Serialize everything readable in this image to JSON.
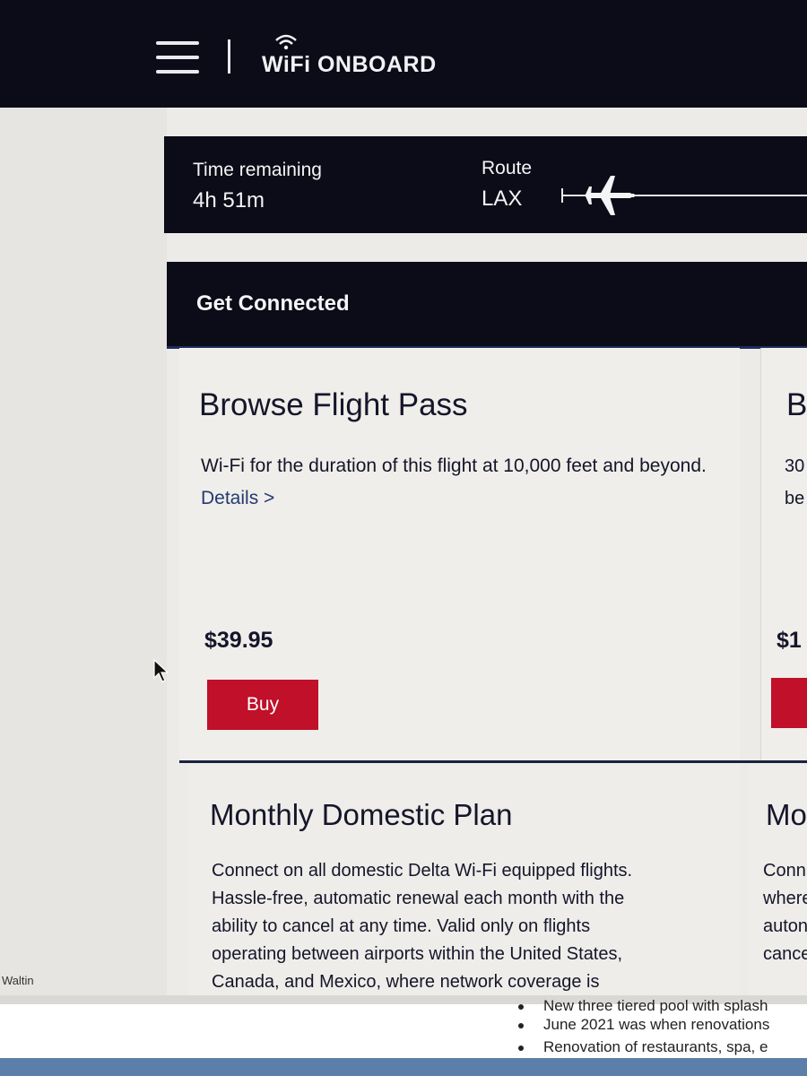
{
  "header": {
    "brand": "WiFi ONBOARD",
    "menu_icon": "hamburger-menu-icon",
    "wifi_icon": "wifi-icon"
  },
  "flight": {
    "time_label": "Time remaining",
    "time_value": "4h 51m",
    "route_label": "Route",
    "route_origin": "LAX",
    "plane_icon": "airplane-icon"
  },
  "section": {
    "title": "Get Connected"
  },
  "plans": [
    {
      "title": "Browse Flight Pass",
      "desc": "Wi-Fi for the duration of this flight at 10,000 feet and beyond.",
      "details_link": "Details >",
      "price": "$39.95",
      "buy_label": "Buy"
    },
    {
      "title_partial": "B",
      "desc_line1": "30",
      "desc_line2": "be",
      "price_partial": "$1"
    }
  ],
  "monthly": [
    {
      "title": "Monthly Domestic Plan",
      "desc_lines": [
        "Connect on all domestic Delta Wi-Fi equipped flights.",
        "Hassle-free, automatic renewal each month with the",
        "ability to cancel at any time. Valid only on flights",
        "operating between airports within the United States,",
        "Canada, and Mexico, where network coverage is"
      ]
    },
    {
      "title_partial": "Mo",
      "desc_lines": [
        "Conn",
        "where",
        "auton",
        "cance"
      ]
    }
  ],
  "background_doc": {
    "left_fragment": "Waltin",
    "bullets": [
      "New three tiered pool with splash",
      "June 2021 was when renovations",
      "Renovation of restaurants, spa, e"
    ]
  },
  "colors": {
    "navy": "#0b0c17",
    "buy_red": "#c0102a",
    "link_blue": "#233a73"
  }
}
